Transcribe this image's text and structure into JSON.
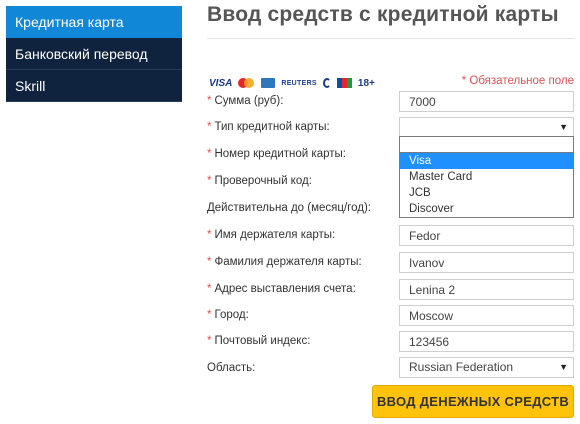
{
  "sidebar": {
    "items": [
      {
        "label": "Кредитная карта"
      },
      {
        "label": "Банковский перевод"
      },
      {
        "label": "Skrill"
      }
    ]
  },
  "page": {
    "title": "Ввод средств с кредитной карты",
    "required_note": "* Обязательное поле"
  },
  "logos": {
    "visa": "VISA",
    "reuters": "REUTERS",
    "age": "18+"
  },
  "form": {
    "amount": {
      "label": "Сумма (руб):",
      "value": "7000"
    },
    "card_type": {
      "label": "Тип кредитной карты:",
      "value": ""
    },
    "card_number": {
      "label": "Номер кредитной карты:"
    },
    "cvv": {
      "label": "Проверочный код:"
    },
    "expiry": {
      "label": "Действительна до (месяц/год):"
    },
    "first_name": {
      "label": "Имя держателя карты:",
      "value": "Fedor"
    },
    "last_name": {
      "label": "Фамилия держателя карты:",
      "value": "Ivanov"
    },
    "address": {
      "label": "Адрес выставления счета:",
      "value": "Lenina 2"
    },
    "city": {
      "label": "Город:",
      "value": "Moscow"
    },
    "zip": {
      "label": "Почтовый индекс:",
      "value": "123456"
    },
    "region": {
      "label": "Область:",
      "value": "Russian Federation"
    }
  },
  "dropdown": {
    "options": [
      "Visa",
      "Master Card",
      "JCB",
      "Discover"
    ],
    "selected": "Visa"
  },
  "submit_label": "ВВОД ДЕНЕЖНЫХ СРЕДСТВ",
  "colors": {
    "sidebar_bg": "#10233e",
    "sidebar_active": "#1187d8",
    "required": "#e05050",
    "button": "#ffc30b",
    "selection": "#1e90ff"
  }
}
